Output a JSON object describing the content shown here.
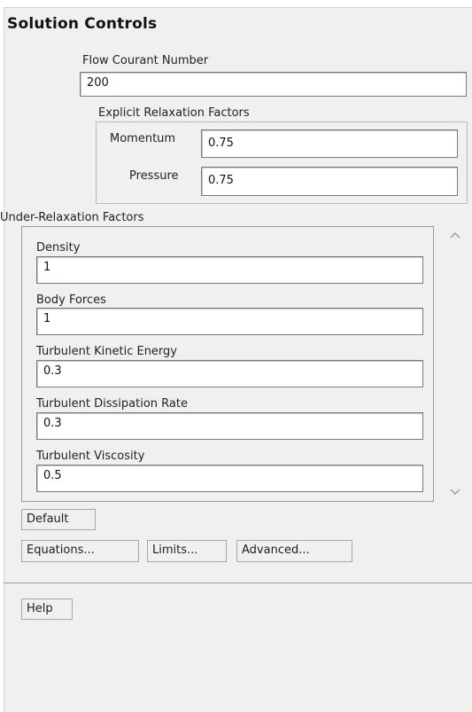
{
  "panel": {
    "title": "Solution Controls"
  },
  "flow_courant": {
    "label": "Flow Courant Number",
    "value": "200"
  },
  "explicit_relaxation": {
    "title": "Explicit Relaxation Factors",
    "momentum": {
      "label": "Momentum",
      "value": "0.75"
    },
    "pressure": {
      "label": "Pressure",
      "value": "0.75"
    }
  },
  "under_relaxation": {
    "title": "Under-Relaxation Factors",
    "fields": [
      {
        "label": "Density",
        "value": "1"
      },
      {
        "label": "Body Forces",
        "value": "1"
      },
      {
        "label": "Turbulent Kinetic Energy",
        "value": "0.3"
      },
      {
        "label": "Turbulent Dissipation Rate",
        "value": "0.3"
      },
      {
        "label": "Turbulent Viscosity",
        "value": "0.5"
      }
    ]
  },
  "buttons": {
    "default": "Default",
    "equations": "Equations...",
    "limits": "Limits...",
    "advanced": "Advanced...",
    "help": "Help"
  },
  "icons": {
    "scroll_up": "chevron-up-icon",
    "scroll_down": "chevron-down-icon"
  }
}
